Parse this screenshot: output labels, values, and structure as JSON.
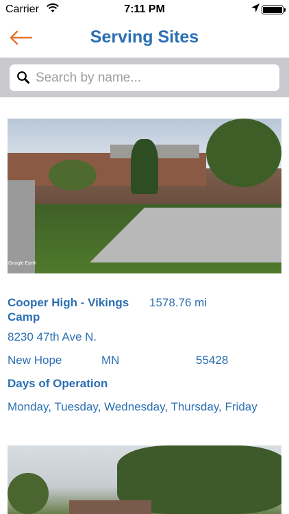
{
  "status_bar": {
    "carrier": "Carrier",
    "time": "7:11 PM"
  },
  "nav": {
    "title": "Serving Sites",
    "back_icon": "back-arrow-icon",
    "accent_color": "#e8742a",
    "title_color": "#2b6fb3"
  },
  "search": {
    "placeholder": "Search by name...",
    "value": ""
  },
  "sites": [
    {
      "name": "Cooper High - Vikings Camp",
      "distance": "1578.76 mi",
      "address": "8230 47th Ave N.",
      "city": "New Hope",
      "state": "MN",
      "zip": "55428",
      "days_label": "Days of Operation",
      "days": "Monday, Tuesday, Wednesday, Thursday, Friday",
      "photo_credit": "Google Earth"
    }
  ]
}
